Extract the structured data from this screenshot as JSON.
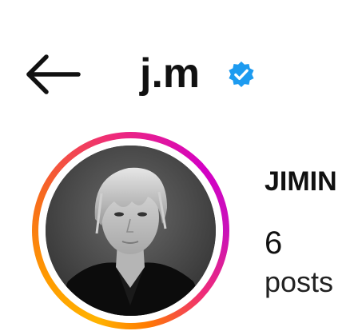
{
  "header": {
    "username": "j.m",
    "back_icon": "arrow-left-icon",
    "verified_icon": "verified-badge-icon"
  },
  "profile": {
    "display_name": "JIMIN",
    "posts_count": "6",
    "posts_label": "posts",
    "avatar_icon": "profile-photo"
  },
  "colors": {
    "verified_blue": "#1d9bf0",
    "story_ring_start": "#ffb300",
    "story_ring_end": "#d300c5",
    "text": "#111111"
  }
}
